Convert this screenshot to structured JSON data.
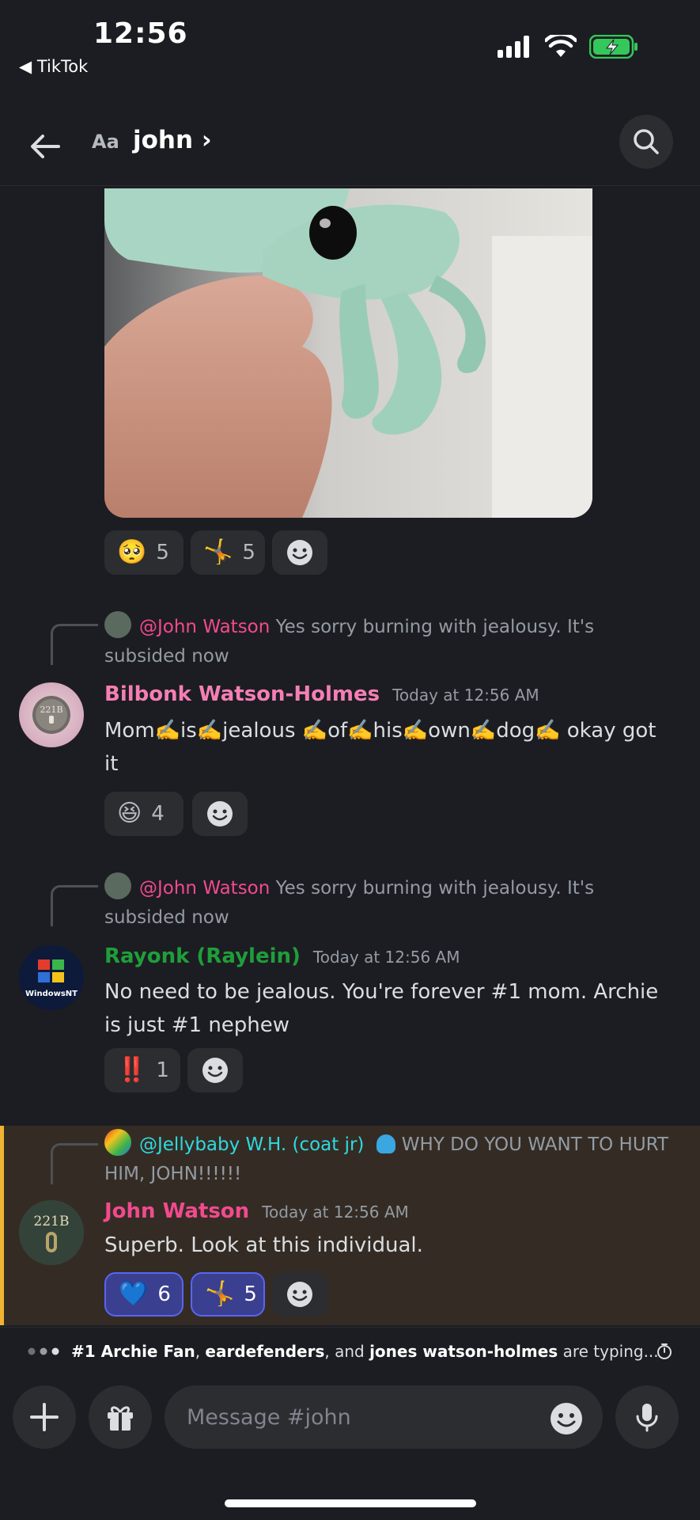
{
  "status_bar": {
    "time": "12:56",
    "back_app": "◀ TikTok"
  },
  "header": {
    "aa": "Aa",
    "channel": "john ›"
  },
  "attachment": {
    "reactions": [
      {
        "emoji": "🥺",
        "count": "5"
      },
      {
        "emoji": "🤸",
        "count": "5"
      }
    ]
  },
  "messages": [
    {
      "reply_mention": "@John Watson",
      "reply_text": "Yes sorry burning with jealousy. It's subsided now",
      "author": "Bilbonk Watson-Holmes",
      "author_color": "#f47fb4",
      "time": "Today at 12:56 AM",
      "text": "Mom✍️is✍️jealous ✍️of✍️his✍️own✍️dog✍️ okay got it",
      "reactions": [
        {
          "emoji": "😆",
          "count": "4"
        }
      ]
    },
    {
      "reply_mention": "@John Watson",
      "reply_text": "Yes sorry burning with jealousy. It's subsided now",
      "author": "Rayonk (Raylein)",
      "author_color": "#1f9e3a",
      "time": "Today at 12:56 AM",
      "text": "No need to be jealous. You're forever #1 mom. Archie is just #1 nephew",
      "reactions": [
        {
          "emoji": "‼️",
          "count": "1"
        }
      ]
    },
    {
      "reply_mention": "@Jellybaby W.H. (coat jr)",
      "reply_text": "WHY DO YOU WANT TO HURT HIM, JOHN!!!!!!",
      "author": "John Watson",
      "author_color": "#f24a8e",
      "time": "Today at 12:56 AM",
      "text": "Superb. Look at this individual.",
      "reactions": [
        {
          "emoji": "💙",
          "count": "6"
        },
        {
          "emoji": "🤸",
          "count": "5"
        }
      ]
    }
  ],
  "typing": {
    "user1": "#1 Archie Fan",
    "sep1": ",",
    "user2": "eardefenders",
    "sep2": ", and",
    "user3": "jones watson-holmes",
    "suffix": "are typing..."
  },
  "composer": {
    "placeholder": "Message #john"
  }
}
